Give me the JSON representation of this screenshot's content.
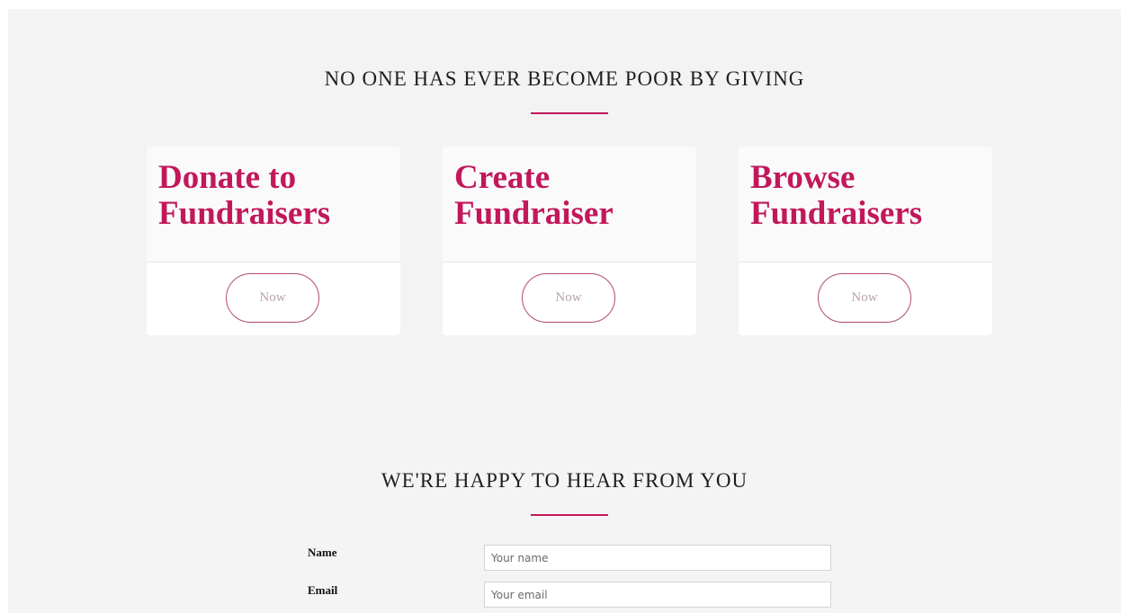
{
  "colors": {
    "accent": "#c2185b",
    "button_border": "#b24a78"
  },
  "giving": {
    "heading": "NO ONE HAS EVER BECOME POOR BY GIVING",
    "cards": [
      {
        "title": "Donate to Fundraisers",
        "button_label": "Now"
      },
      {
        "title": "Create Fundraiser",
        "button_label": "Now"
      },
      {
        "title": "Browse Fundraisers",
        "button_label": "Now"
      }
    ]
  },
  "contact": {
    "heading": "WE'RE HAPPY TO HEAR FROM YOU",
    "name_label": "Name",
    "name_placeholder": "Your name",
    "email_label": "Email",
    "email_placeholder": "Your email"
  }
}
